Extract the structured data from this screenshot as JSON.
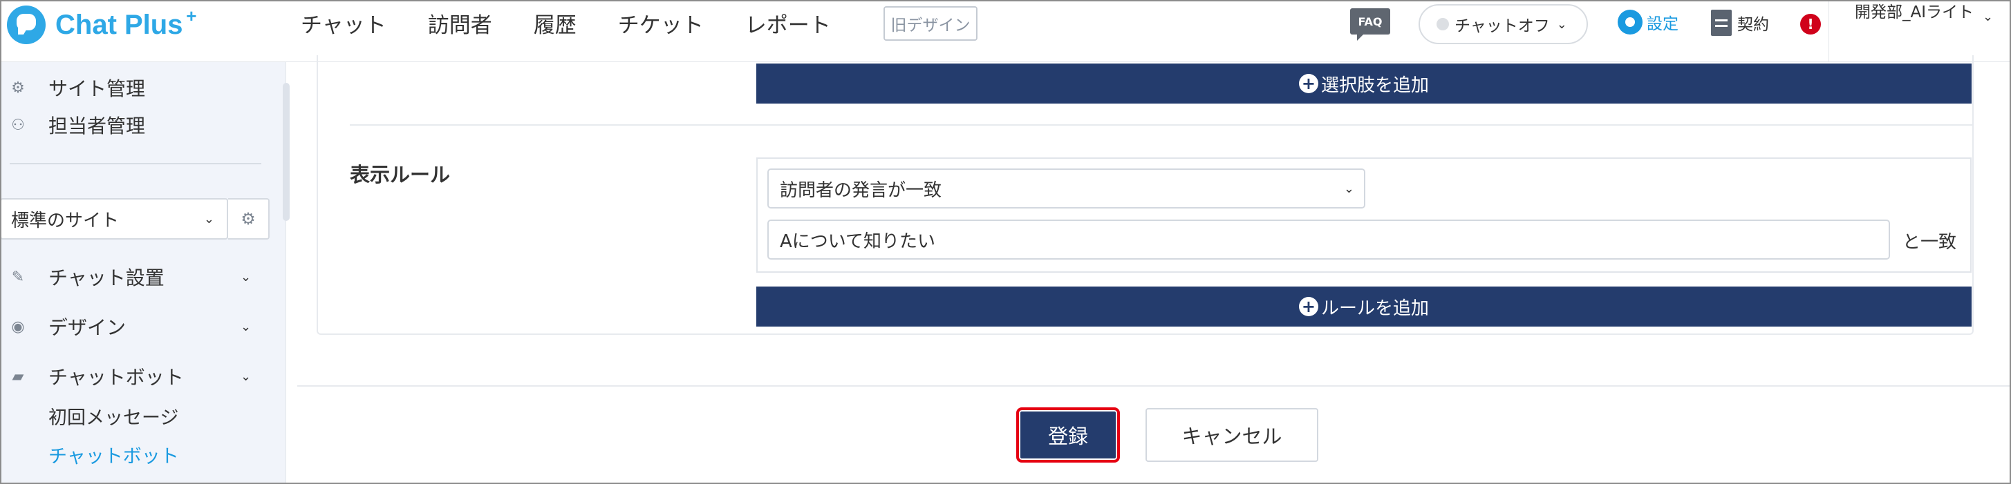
{
  "header": {
    "logo_text": "Chat Plus",
    "logo_sup": "+",
    "nav": [
      "チャット",
      "訪問者",
      "履歴",
      "チケット",
      "レポート"
    ],
    "old_design_label": "旧デザイン",
    "faq_label": "FAQ",
    "chat_status_label": "チャットオフ",
    "settings_label": "設定",
    "contract_label": "契約",
    "alert_label": "!",
    "user_name": "開発部_AIライト"
  },
  "sidebar": {
    "items_top": [
      {
        "icon": "gear-icon",
        "label": "サイト管理"
      },
      {
        "icon": "users-icon",
        "label": "担当者管理"
      }
    ],
    "site_select_value": "標準のサイト",
    "menu": [
      {
        "icon": "tools-icon",
        "label": "チャット設置"
      },
      {
        "icon": "palette-icon",
        "label": "デザイン"
      },
      {
        "icon": "chat-icon",
        "label": "チャットボット"
      }
    ],
    "sub_items": [
      {
        "label": "初回メッセージ",
        "active": false
      },
      {
        "label": "チャットボット",
        "active": true
      }
    ]
  },
  "main": {
    "add_choice_label": "選択肢を追加",
    "display_rule_label": "表示ルール",
    "rule_condition_value": "訪問者の発言が一致",
    "rule_text_value": "Aについて知りたい",
    "rule_match_label": "と一致",
    "add_rule_label": "ルールを追加",
    "save_label": "登録",
    "cancel_label": "キャンセル"
  },
  "colors": {
    "brand": "#2ea8e6",
    "primary_button": "#243c6d",
    "link": "#1a9ae0",
    "highlight_border": "#e60012",
    "alert": "#d0021b"
  }
}
